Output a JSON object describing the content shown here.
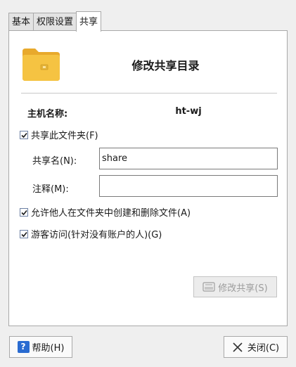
{
  "tabs": [
    {
      "label": "基本"
    },
    {
      "label": "权限设置"
    },
    {
      "label": "共享"
    }
  ],
  "header": {
    "title": "修改共享目录",
    "icon": "folder-icon"
  },
  "host": {
    "label": "主机名称:",
    "value": "ht-wj"
  },
  "share_folder": {
    "label": "共享此文件夹(F)",
    "checked": true
  },
  "share_name": {
    "label": "共享名(N):",
    "value": "share"
  },
  "comment": {
    "label": "注释(M):",
    "value": ""
  },
  "allow_others": {
    "label": "允许他人在文件夹中创建和删除文件(A)",
    "checked": true
  },
  "guest_access": {
    "label": "游客访问(针对没有账户的人)(G)",
    "checked": true
  },
  "modify_button": {
    "label": "修改共享(S)",
    "enabled": false
  },
  "help_button": {
    "label": "帮助(H)",
    "icon_text": "?"
  },
  "close_button": {
    "label": "关闭(C)"
  },
  "colors": {
    "folder": "#f5c342",
    "help_icon": "#2a6bd1",
    "checkbox_border": "#6b7fa3"
  }
}
